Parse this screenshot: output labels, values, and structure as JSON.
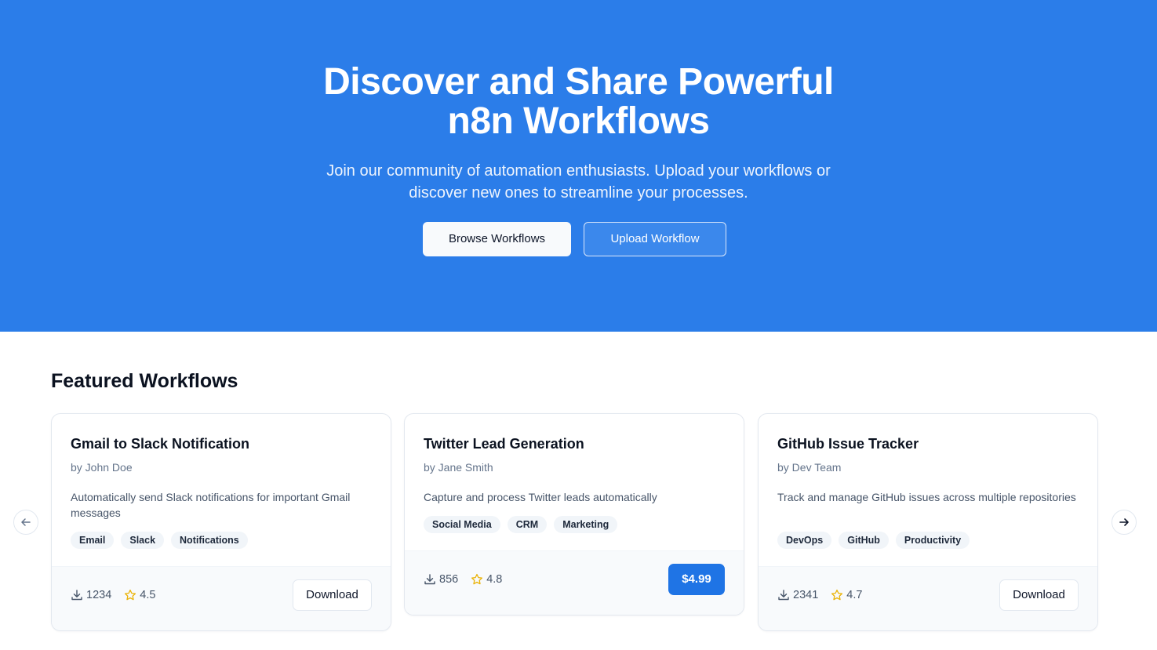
{
  "hero": {
    "title_line1": "Discover and Share Powerful",
    "title_line2": "n8n Workflows",
    "subtitle_line1": "Join our community of automation enthusiasts. Upload your workflows or",
    "subtitle_line2": "discover new ones to streamline your processes.",
    "browse_label": "Browse Workflows",
    "upload_label": "Upload Workflow",
    "background_color": "#2b7de9"
  },
  "featured": {
    "heading": "Featured Workflows",
    "prev_icon": "arrow-left-icon",
    "next_icon": "arrow-right-icon",
    "cards": [
      {
        "title": "Gmail to Slack Notification",
        "author": "by John Doe",
        "description": "Automatically send Slack notifications for important Gmail messages",
        "tags": [
          "Email",
          "Slack",
          "Notifications"
        ],
        "downloads": "1234",
        "rating": "4.5",
        "action_label": "Download"
      },
      {
        "title": "Twitter Lead Generation",
        "author": "by Jane Smith",
        "description": "Capture and process Twitter leads automatically",
        "tags": [
          "Social Media",
          "CRM",
          "Marketing"
        ],
        "downloads": "856",
        "rating": "4.8",
        "action_label": "$4.99"
      },
      {
        "title": "GitHub Issue Tracker",
        "author": "by Dev Team",
        "description": "Track and manage GitHub issues across multiple repositories",
        "tags": [
          "DevOps",
          "GitHub",
          "Productivity"
        ],
        "downloads": "2341",
        "rating": "4.7",
        "action_label": "Download"
      }
    ],
    "price_button_color": "#1f74e5",
    "star_color": "#eab308"
  }
}
